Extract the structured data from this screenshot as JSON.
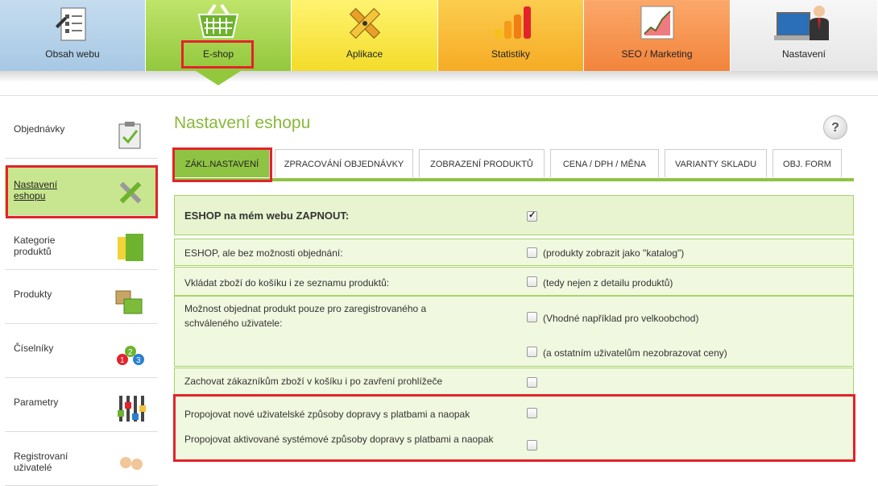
{
  "topnav": {
    "tabs": [
      {
        "label": "Obsah webu",
        "icon": "document-list-icon"
      },
      {
        "label": "E-shop",
        "icon": "shopping-basket-icon"
      },
      {
        "label": "Aplikace",
        "icon": "pencil-ruler-icon"
      },
      {
        "label": "Statistiky",
        "icon": "bar-chart-icon"
      },
      {
        "label": "SEO / Marketing",
        "icon": "growth-chart-icon"
      },
      {
        "label": "Nastavení",
        "icon": "user-laptop-icon"
      }
    ],
    "active": "E-shop"
  },
  "sidebar": {
    "items": [
      {
        "label": "Objednávky",
        "icon": "clipboard-check-icon"
      },
      {
        "label": "Nastavení eshopu",
        "icon": "wrench-tools-icon",
        "active": true
      },
      {
        "label": "Kategorie produktů",
        "icon": "folders-icon"
      },
      {
        "label": "Produkty",
        "icon": "boxes-icon"
      },
      {
        "label": "Číselníky",
        "icon": "numbers-icon"
      },
      {
        "label": "Parametry",
        "icon": "sliders-icon"
      },
      {
        "label": "Registrovaní uživatelé",
        "icon": "users-icon"
      }
    ]
  },
  "main": {
    "title": "Nastavení eshopu",
    "help_label": "?",
    "tabs": [
      {
        "label": "ZÁKL.NASTAVENÍ",
        "active": true
      },
      {
        "label": "ZPRACOVÁNÍ OBJEDNÁVKY"
      },
      {
        "label": "ZOBRAZENÍ PRODUKTŮ"
      },
      {
        "label": "CENA / DPH / MĚNA"
      },
      {
        "label": "VARIANTY SKLADU"
      },
      {
        "label": "OBJ. FORM"
      }
    ],
    "settings": [
      {
        "label": "ESHOP na mém webu ZAPNOUT:",
        "checked": true,
        "note": ""
      },
      {
        "label": "ESHOP, ale bez možnosti objednání:",
        "checked": false,
        "note": "(produkty zobrazit jako \"katalog\")"
      },
      {
        "label": "Vkládat zboží do košíku i ze seznamu produktů:",
        "checked": false,
        "note": "(tedy nejen z detailu produktů)"
      },
      {
        "label": "Možnost objednat produkt pouze pro zaregistrovaného a schváleného uživatele:",
        "checked": false,
        "note": "(Vhodné například pro velkoobchod)",
        "note2": "(a ostatním uživatelům nezobrazovat ceny)",
        "checked2": false
      },
      {
        "label": "Zachovat zákazníkům zboží v košíku i po zavření prohlížeče",
        "checked": false,
        "note": ""
      },
      {
        "label": "Propojovat nové uživatelské způsoby dopravy s platbami a naopak",
        "checked": false,
        "note": ""
      },
      {
        "label": "Propojovat aktivované systémové způsoby dopravy s platbami a naopak",
        "checked": false,
        "note": ""
      }
    ]
  },
  "colors": {
    "accent_green": "#8fc343",
    "highlight_red": "#e3232b",
    "title_green": "#8ab83a"
  }
}
